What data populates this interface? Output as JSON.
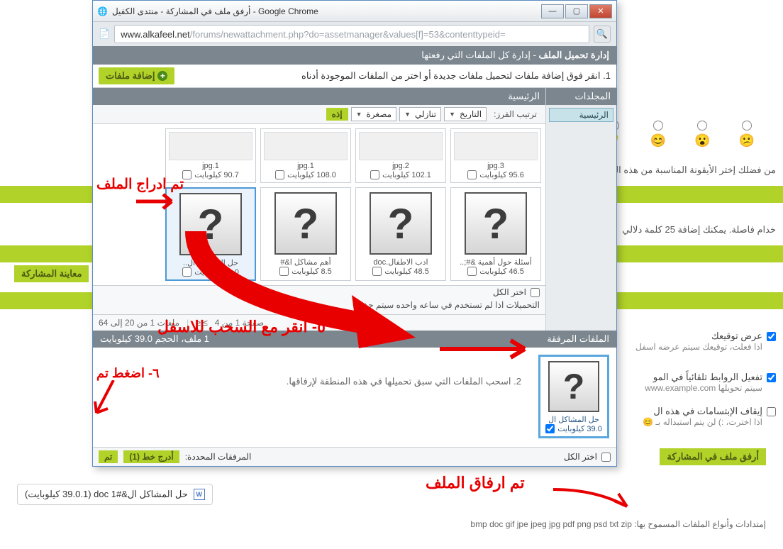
{
  "window": {
    "title": "أرفق ملف في المشاركة - منتدى الكفيل - Google Chrome",
    "url_host": "www.alkafeel.net",
    "url_path": "/forums/newattachment.php?do=assetmanager&values[f]=53&contenttypeid=",
    "min": "—",
    "max": "▢",
    "close": "✕"
  },
  "header": {
    "title": "إدارة تحميل الملف",
    "subtitle": "- إدارة كل الملفات التي رفعتها"
  },
  "step1": {
    "text": "1. انقر فوق إضافة ملفات لتحميل ملفات جديدة أو اختر من الملفات الموجودة أدناه",
    "add_files": "إضافة ملفات"
  },
  "sidebar": {
    "title": "المجلدات",
    "root": "الرئيسية"
  },
  "sort": {
    "heading": "الرئيسية",
    "label": "ترتيب الفرز:",
    "by": "التاريخ",
    "dir": "تنازلي",
    "size": "مصغرة",
    "go": "إذه"
  },
  "tiles_top": [
    {
      "name": "jpg.3",
      "size": "95.6 كيلوبايت"
    },
    {
      "name": "jpg.2",
      "size": "102.1 كيلوبايت"
    },
    {
      "name": "jpg.1",
      "size": "108.0 كيلوبايت"
    },
    {
      "name": "jpg.1",
      "size": "90.7 كيلوبايت"
    }
  ],
  "tiles_q": [
    {
      "name": "أسئلة حول أهمية &#;..",
      "size": "46.5 كيلوبايت"
    },
    {
      "name": "ادب الاطفال.doc",
      "size": "48.5 كيلوبايت"
    },
    {
      "name": "أهم مشاكل ا&#",
      "size": "8.5 كيلوبايت"
    },
    {
      "name": "حل المشاكل ال&#1;..",
      "size": "39.0 كيلوبايت",
      "selected": true
    }
  ],
  "select_all": "اختر الكل",
  "hint_unused": "التحميلات اذا لم تستخدم في ساعه واحده سيتم حذفها",
  "pager_pages": "صفحة 1 من 4",
  "pager_items": "ملفات 1 من 20 إلى 64",
  "pager_nav": "≥ ≤",
  "attached": {
    "title": "الملفات المرفقة",
    "summary": "1 ملف، الحجم 39.0 كيلوبايت",
    "drop_text": "2. اسحب الملفات التي سبق تحميلها في هذه المنطقة لإرفاقها.",
    "tile_name": "حل المشاكل ال",
    "tile_size": "39.0 كيلوبايت"
  },
  "footer": {
    "select_all": "اختر الكل",
    "selected_label": "المرفقات المحددة:",
    "insert_line": "أدرج خط (1)",
    "done": "تم"
  },
  "bg": {
    "list_text": "من فضلك إختر الأيقونة المناسبة من هذه القائمة",
    "tags_text": "خدام فاصلة. يمكنك إضافة 25 كلمة دلالي",
    "preview": "معاينة المشاركة",
    "show_sig": "عرض توقيعك",
    "show_sig_sub": "اذا فعلت، توقيعك سيتم عرضه اسفل",
    "auto_links": "تفعيل الروابط تلقائياً في المو",
    "auto_links_sub": "سيتم تحويلها www.example.com",
    "stop_smilies": "إيقاف الإبتسامات في هذه ال",
    "stop_smilies_sub": "اذا اخترت، :) لن يتم استبداله بـ 😊",
    "attach_title": "أرفق ملف في المشاركة",
    "attach_file": "حل المشاكل ال&#1 doc (39.0.1 كيلوبايت)",
    "allowed": "إمتدادات وأنواع الملفات المسموح بها: bmp doc gif jpe jpeg jpg pdf png psd txt zip"
  },
  "annotations": {
    "a1": "تم ادراج الملف",
    "a2": "٥- انقر مع السحب للاسفل",
    "a3": "٦- اضغط تم",
    "a4": "تم ارفاق الملف"
  },
  "icons": {
    "search": "🔍",
    "page": "📄"
  }
}
